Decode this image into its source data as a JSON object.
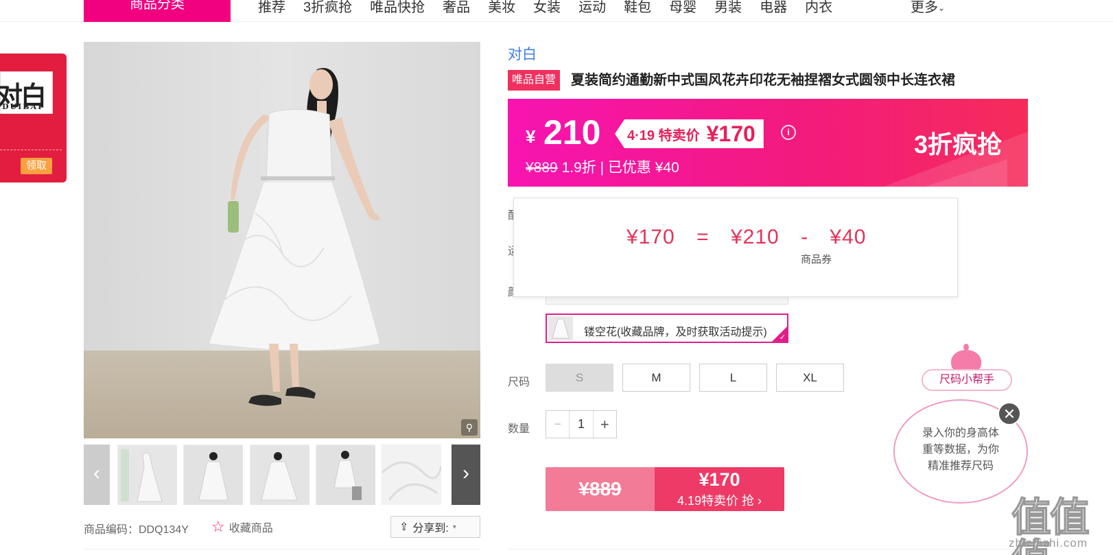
{
  "nav": {
    "category_button": "商品分类",
    "links": [
      "推荐",
      "3折疯抢",
      "唯品快抢",
      "奢品",
      "美妆",
      "女装",
      "运动",
      "鞋包",
      "母婴",
      "男装",
      "电器",
      "内衣"
    ],
    "more": "更多"
  },
  "brand_coupon": {
    "logo_text": "对白",
    "logo_sub": "DUIBAI",
    "claim_label": "领取"
  },
  "gallery": {
    "zoom_icon": "magnifier-icon",
    "prev_icon": "chevron-left-icon",
    "next_icon": "chevron-right-icon"
  },
  "product_meta": {
    "code_label": "商品编码：DDQ134Y",
    "favorite_label": "收藏商品",
    "share_label": "分享到:"
  },
  "product": {
    "brand": "对白",
    "self_operated_badge": "唯品自营",
    "title": "夏装简约通勤新中式国风花卉印花无袖捏褶女式圆领中长连衣裙"
  },
  "price": {
    "currency": "¥",
    "sale_price": "210",
    "deal_label": "4·19 特卖价",
    "deal_price": "¥170",
    "original_price": "¥889",
    "discount_text": "1.9折 | 已优惠 ¥40",
    "promo_label": "3折疯抢",
    "colors": {
      "band_start": "#f714b2",
      "band_end": "#f52c5a"
    }
  },
  "price_popup": {
    "final": "¥170",
    "eq": "=",
    "base": "¥210",
    "minus": "-",
    "coupon": "¥40",
    "coupon_note": "商品券"
  },
  "options": {
    "color_hidden_label_1": "配",
    "color_hidden_label_2": "运",
    "color_hidden_label_3": "颜",
    "color_option_label": "镂空花(收藏品牌，及时获取活动提示)",
    "size_label": "尺码",
    "sizes": [
      "S",
      "M",
      "L",
      "XL"
    ],
    "quantity_label": "数量",
    "quantity_value": "1",
    "minus": "−",
    "plus": "+"
  },
  "buy": {
    "original_price": "¥889",
    "deal_price": "¥170",
    "deal_cta": "4.19特卖价 抢 ›"
  },
  "size_helper": {
    "tag": "尺码小帮手",
    "line1": "录入你的身高体",
    "line2": "重等数据，为你",
    "line3": "精准推荐尺码",
    "close": "✕"
  },
  "watermark": {
    "big": "值值值",
    "small": "zhizhizhi.com"
  }
}
